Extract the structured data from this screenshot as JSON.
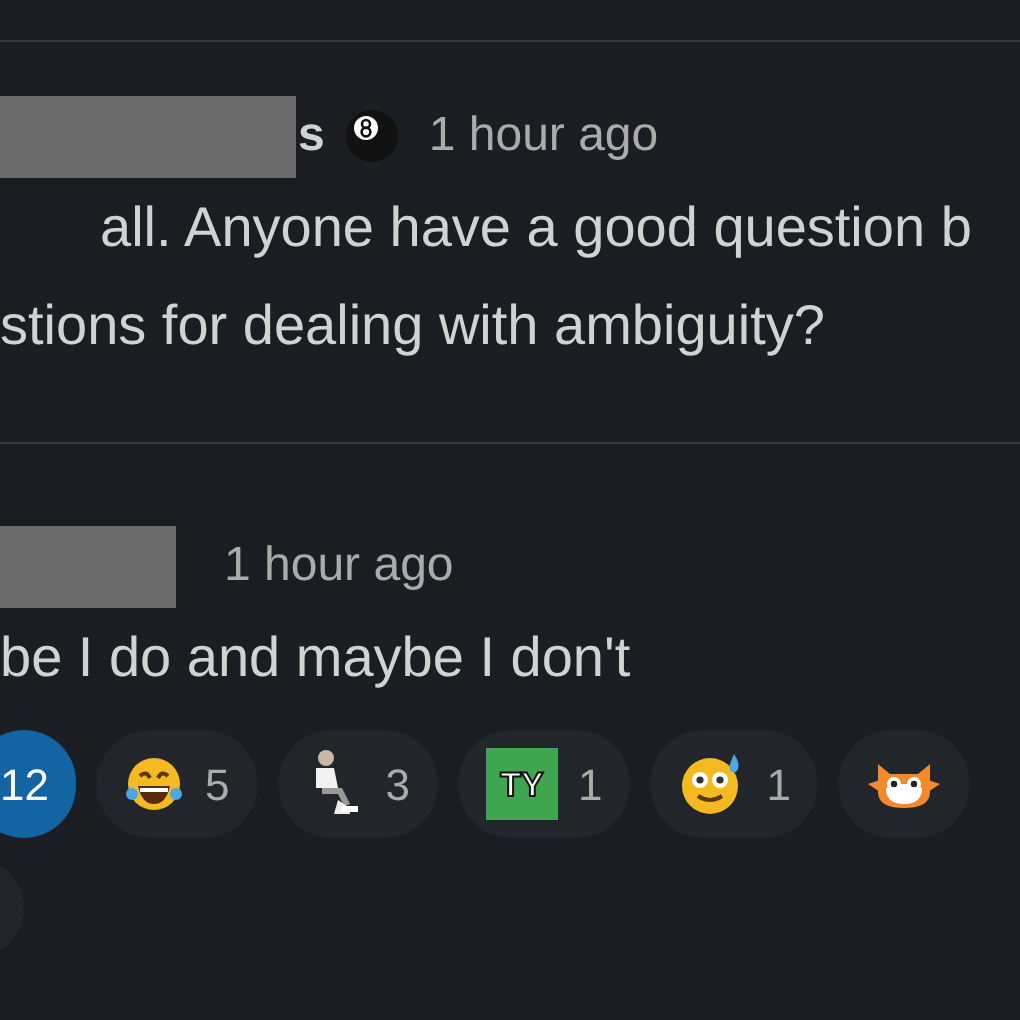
{
  "messages": [
    {
      "author_fragment": "s",
      "status_icon": true,
      "time": "1 hour ago",
      "indent": true,
      "lines": [
        "all. Anyone have a good question b",
        "stions for dealing with ambiguity?"
      ]
    },
    {
      "status_icon": false,
      "time": "1 hour ago",
      "indent": false,
      "lines": [
        "be I do and maybe I don't"
      ]
    }
  ],
  "reactions": [
    {
      "kind": "cut",
      "count": "12",
      "selected": true
    },
    {
      "kind": "laugh",
      "count": "5",
      "selected": false
    },
    {
      "kind": "sitting",
      "count": "3",
      "selected": false
    },
    {
      "kind": "ty",
      "label": "TY",
      "count": "1",
      "selected": false
    },
    {
      "kind": "sweat",
      "count": "1",
      "selected": false
    },
    {
      "kind": "cat",
      "selected": false
    }
  ]
}
